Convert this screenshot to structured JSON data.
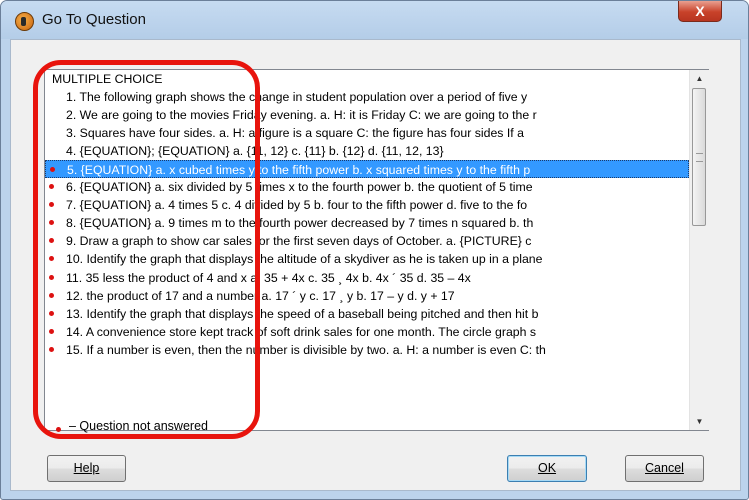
{
  "window": {
    "title": "Go To Question",
    "close_label": "X"
  },
  "list": {
    "header": "MULTIPLE CHOICE",
    "selected_index": 4,
    "items": [
      {
        "text": "1. The following graph shows the change in student population over a period of five y",
        "unanswered": false
      },
      {
        "text": "2. We are going to the movies Friday evening. a. H: it is Friday C: we are going to the r",
        "unanswered": false
      },
      {
        "text": "3. Squares have four sides. a. H: a figure is a square C: the figure has four sides If a",
        "unanswered": false
      },
      {
        "text": "4. {EQUATION}; {EQUATION} a. {11, 12} c. {11} b. {12} d. {11, 12, 13}",
        "unanswered": false
      },
      {
        "text": "5. {EQUATION} a. x cubed times y to the fifth power b. x squared times y to the fifth p",
        "unanswered": true
      },
      {
        "text": "6. {EQUATION} a. six divided by 5 times x to the fourth power b. the quotient of 5 time",
        "unanswered": true
      },
      {
        "text": "7. {EQUATION} a. 4 times 5 c. 4 divided by 5 b. four to the fifth power d. five to the fo",
        "unanswered": true
      },
      {
        "text": "8. {EQUATION} a. 9 times m to the fourth power decreased by 7 times n squared b. th",
        "unanswered": true
      },
      {
        "text": "9. Draw a graph to show car sales for the first seven days of October. a. {PICTURE} c",
        "unanswered": true
      },
      {
        "text": "10. Identify the graph that displays the altitude of a skydiver as he is taken up in a plane",
        "unanswered": true
      },
      {
        "text": "11. 35 less the product of 4 and x a. 35 + 4x c. 35 ¸ 4x b. 4x ´ 35 d. 35 – 4x",
        "unanswered": true
      },
      {
        "text": "12. the product of 17 and a number a. 17 ´ y c. 17 ¸ y b. 17 – y d. y + 17",
        "unanswered": true
      },
      {
        "text": "13. Identify the graph that displays the speed of a baseball being pitched and then hit b",
        "unanswered": true
      },
      {
        "text": "14. A convenience store kept track of soft drink sales for one month. The circle graph s",
        "unanswered": true
      },
      {
        "text": "15. If a number is even, then the number is divisible by two. a. H: a number is even C: th",
        "unanswered": true
      }
    ]
  },
  "legend": {
    "text": "– Question not answered"
  },
  "buttons": {
    "help": "Help",
    "ok": "OK",
    "cancel": "Cancel"
  },
  "colors": {
    "selection": "#3399ff",
    "unanswered_dot": "#dd1111",
    "annotation_ring": "#e8140d"
  }
}
